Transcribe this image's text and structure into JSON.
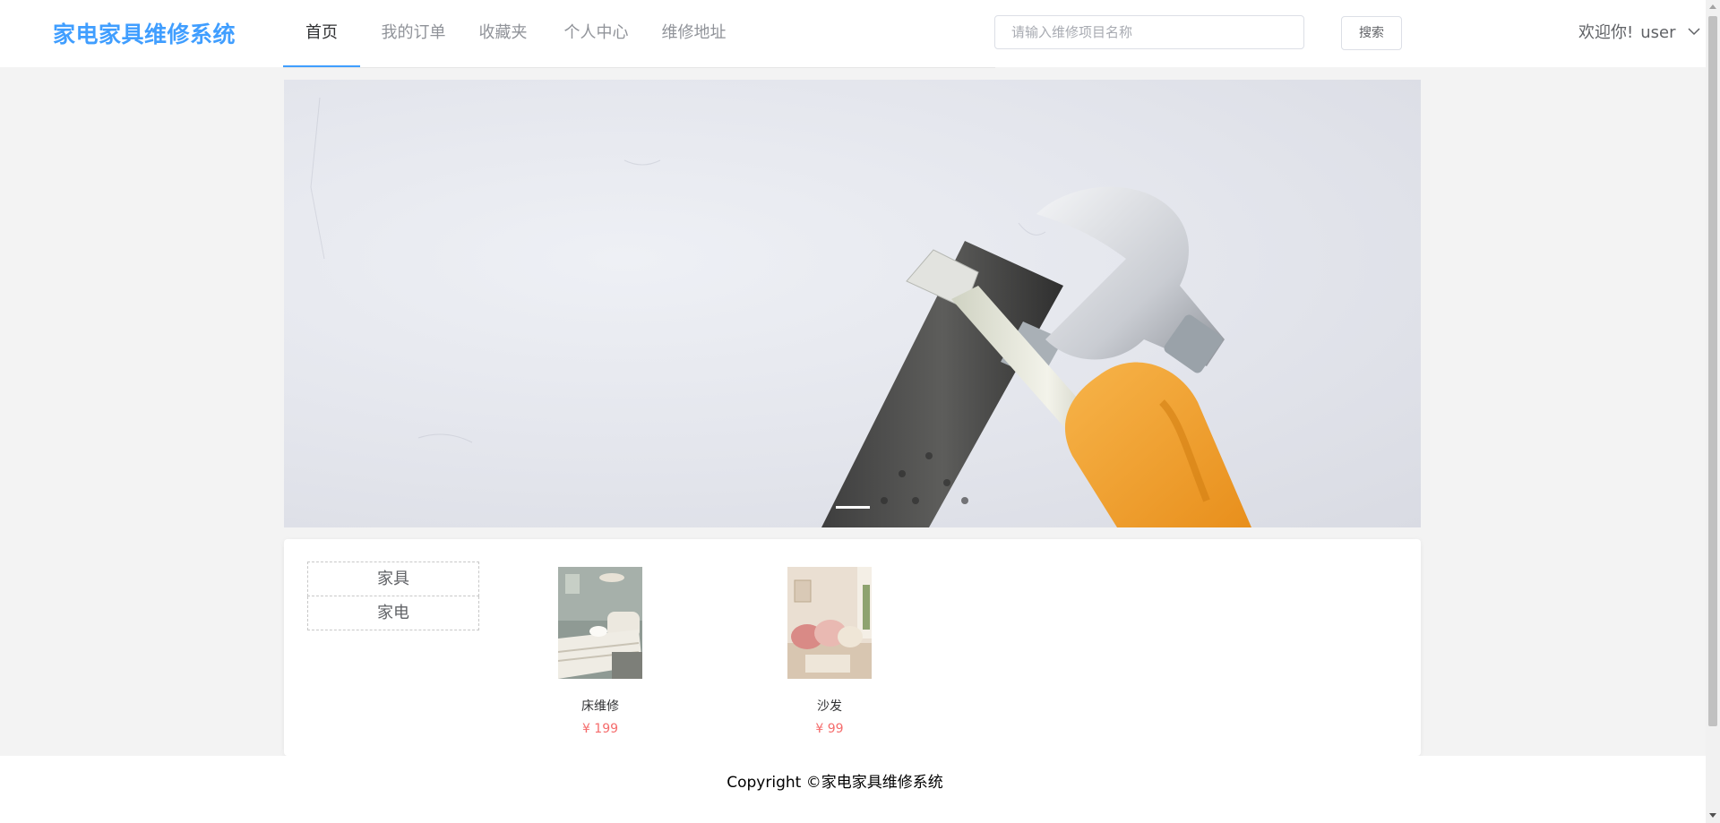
{
  "header": {
    "logo": "家电家具维修系统",
    "nav": [
      {
        "label": "首页",
        "active": true
      },
      {
        "label": "我的订单",
        "active": false
      },
      {
        "label": "收藏夹",
        "active": false
      },
      {
        "label": "个人中心",
        "active": false
      },
      {
        "label": "维修地址",
        "active": false
      }
    ],
    "search": {
      "placeholder": "请输入维修项目名称",
      "value": "",
      "button": "搜索"
    },
    "user": {
      "greeting": "欢迎你!",
      "name": "user"
    }
  },
  "banner": {
    "active_slide": 1,
    "slide_count": 1
  },
  "categories": [
    {
      "label": "家具"
    },
    {
      "label": "家电"
    }
  ],
  "products": [
    {
      "name": "床维修",
      "price": "¥ 199"
    },
    {
      "name": "沙发",
      "price": "¥ 99"
    }
  ],
  "footer": {
    "copyright": "Copyright ©家电家具维修系统"
  },
  "colors": {
    "brand": "#409eff",
    "price": "#f56c6c",
    "nav_active_border": "#409eff"
  }
}
